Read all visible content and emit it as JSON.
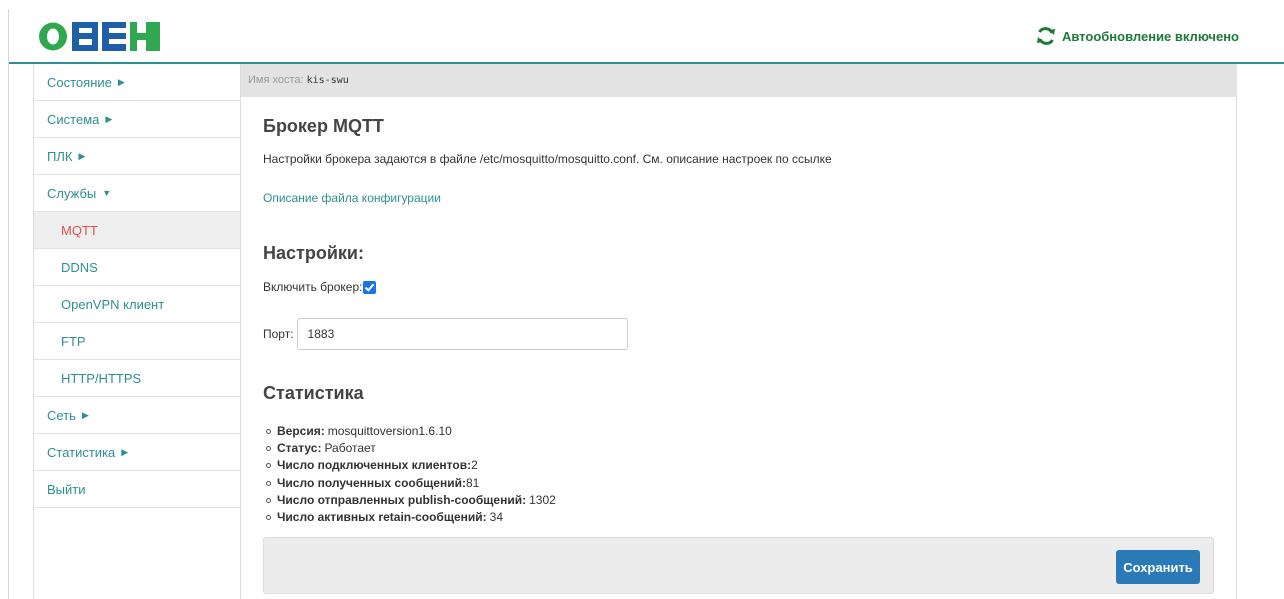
{
  "brand": {
    "logo_text": "ОВЕН"
  },
  "header": {
    "autoupdate_label": "Автообновление включено"
  },
  "sidebar": {
    "items": [
      {
        "label": "Состояние",
        "caret": "▶"
      },
      {
        "label": "Система",
        "caret": "▶"
      },
      {
        "label": "ПЛК",
        "caret": "▶"
      },
      {
        "label": "Службы",
        "caret": "▼"
      }
    ],
    "sub_items": [
      {
        "label": "MQTT"
      },
      {
        "label": "DDNS"
      },
      {
        "label": "OpenVPN клиент"
      },
      {
        "label": "FTP"
      },
      {
        "label": "HTTP/HTTPS"
      }
    ],
    "items_after": [
      {
        "label": "Сеть",
        "caret": "▶"
      },
      {
        "label": "Статистика",
        "caret": "▶"
      },
      {
        "label": "Выйти"
      }
    ]
  },
  "hostbar": {
    "label": "Имя хоста:",
    "value": "kis-swu"
  },
  "main": {
    "title": "Брокер MQTT",
    "description": "Настройки брокера задаются в файле /etc/mosquitto/mosquitto.conf. См. описание настроек по ссылке",
    "doc_link": "Описание файла конфигурации",
    "settings_heading": "Настройки:",
    "enable_label": "Включить брокер:",
    "enable_checked": true,
    "port_label": "Порт:",
    "port_value": "1883",
    "stats_heading": "Статистика",
    "stats": [
      {
        "label": "Версия:",
        "value": "mosquittoversion1.6.10"
      },
      {
        "label": "Статус:",
        "value": "Работает"
      },
      {
        "label": "Число подключенных клиентов:",
        "value": "2"
      },
      {
        "label": "Число полученных сообщений:",
        "value": "81"
      },
      {
        "label": "Число отправленных publish-сообщений:",
        "value": "1302"
      },
      {
        "label": "Число активных retain-сообщений:",
        "value": "34"
      }
    ],
    "save_label": "Сохранить"
  },
  "colors": {
    "accent": "#2d8f95",
    "active": "#d9534f",
    "brand_blue": "#1f5fa8",
    "brand_green": "#2fa84f",
    "save_button": "#2a7ab8"
  }
}
